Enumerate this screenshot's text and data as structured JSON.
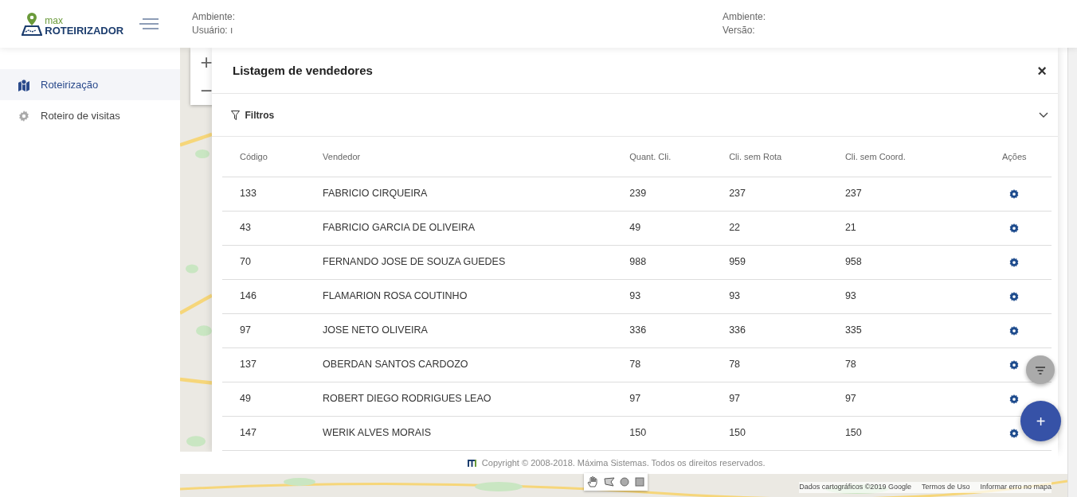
{
  "header": {
    "logo": {
      "small": "max",
      "big": "ROTEIRIZADOR"
    },
    "info_left": [
      "Ambiente:",
      "Usuário: ı"
    ],
    "info_right": [
      "Ambiente:",
      "Versão:"
    ]
  },
  "sidebar": {
    "items": [
      {
        "label": "Roteirização",
        "selected": true
      },
      {
        "label": "Roteiro de visitas",
        "selected": false
      }
    ]
  },
  "map": {
    "zoom_in": "+",
    "zoom_out": "−",
    "attribution": [
      "Dados cartográficos ©2019 Google",
      "Termos de Uso",
      "Informar erro no mapa"
    ]
  },
  "modal": {
    "title": "Listagem de vendedores",
    "close": "×",
    "filters": {
      "label": "Filtros",
      "expanded": false
    },
    "table": {
      "columns": [
        "Código",
        "Vendedor",
        "Quant. Cli.",
        "Cli. sem Rota",
        "Cli. sem Coord.",
        "Ações"
      ],
      "rows": [
        [
          "133",
          "FABRICIO CIRQUEIRA",
          "239",
          "237",
          "237"
        ],
        [
          "43",
          "FABRICIO GARCIA DE OLIVEIRA",
          "49",
          "22",
          "21"
        ],
        [
          "70",
          "FERNANDO JOSE DE SOUZA GUEDES",
          "988",
          "959",
          "958"
        ],
        [
          "146",
          "FLAMARION ROSA COUTINHO",
          "93",
          "93",
          "93"
        ],
        [
          "97",
          "JOSE NETO OLIVEIRA",
          "336",
          "336",
          "335"
        ],
        [
          "137",
          "OBERDAN SANTOS CARDOZO",
          "78",
          "78",
          "78"
        ],
        [
          "49",
          "ROBERT DIEGO RODRIGUES LEAO",
          "97",
          "97",
          "97"
        ],
        [
          "147",
          "WERIK ALVES MORAIS",
          "150",
          "150",
          "150"
        ]
      ]
    }
  },
  "fab_add": "+",
  "footer": {
    "copyright": "Copyright © 2008-2018. Máxima Sistemas. Todos os direitos reservados."
  }
}
